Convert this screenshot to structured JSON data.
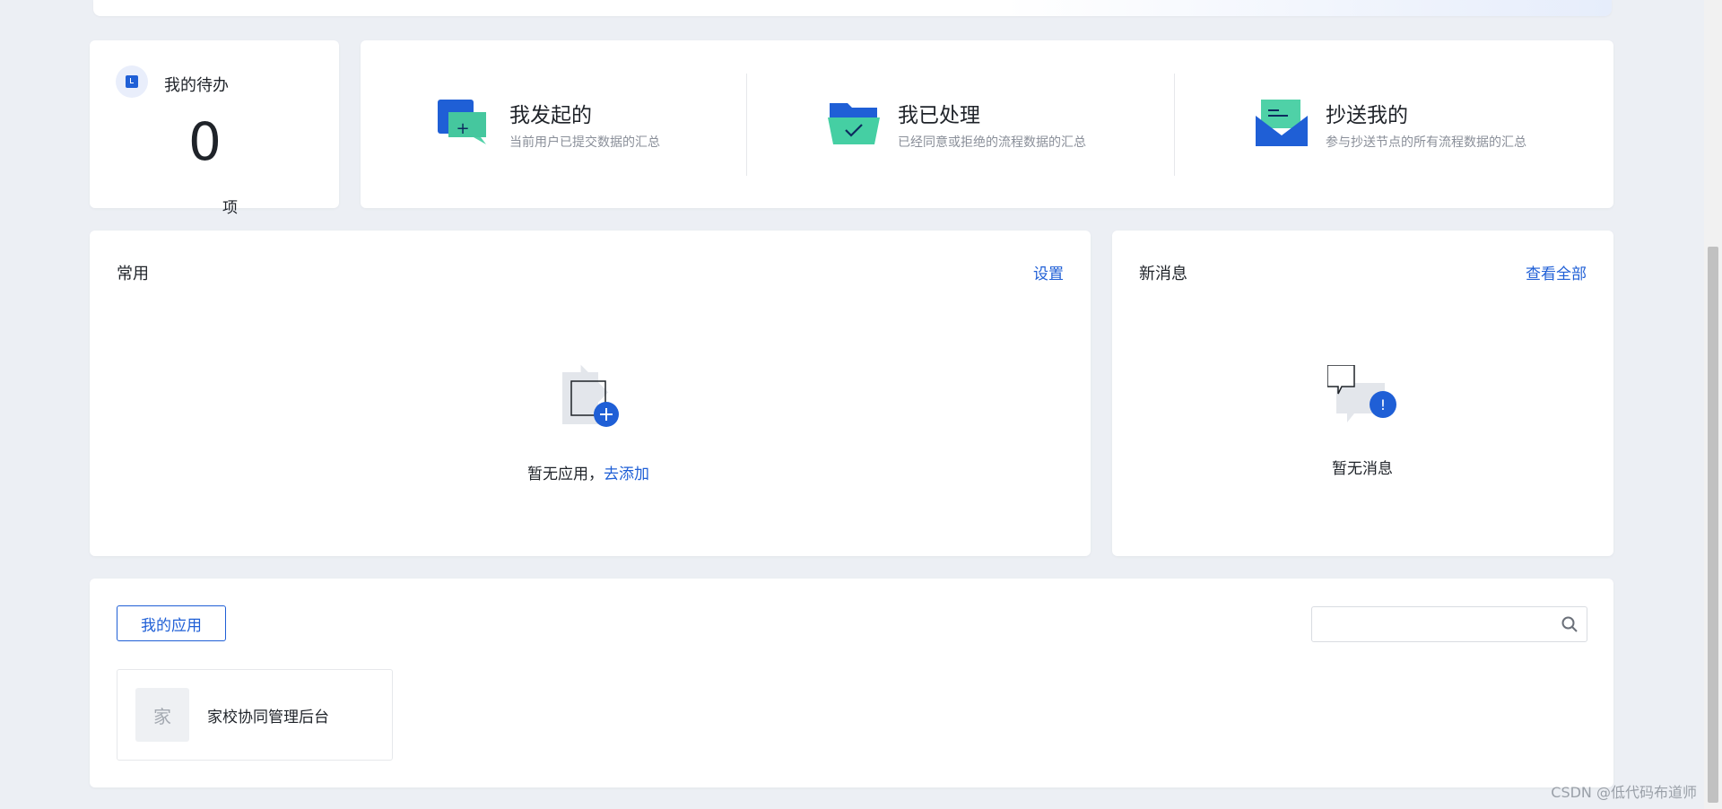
{
  "todo": {
    "title": "我的待办",
    "count": "0",
    "unit": "项"
  },
  "stats": [
    {
      "name": "我发起的",
      "desc": "当前用户已提交数据的汇总"
    },
    {
      "name": "我已处理",
      "desc": "已经同意或拒绝的流程数据的汇总"
    },
    {
      "name": "抄送我的",
      "desc": "参与抄送节点的所有流程数据的汇总"
    }
  ],
  "common": {
    "title": "常用",
    "settings": "设置",
    "empty_text": "暂无应用，",
    "empty_link": "去添加"
  },
  "messages": {
    "title": "新消息",
    "view_all": "查看全部",
    "empty_text": "暂无消息"
  },
  "myapps": {
    "tab": "我的应用",
    "search_placeholder": "",
    "apps": [
      {
        "avatar": "家",
        "name": "家校协同管理后台"
      }
    ]
  },
  "watermark": "CSDN @低代码布道师",
  "colors": {
    "accent": "#1f5fd6",
    "background": "#eceff4",
    "muted_text": "#8a8f99"
  }
}
